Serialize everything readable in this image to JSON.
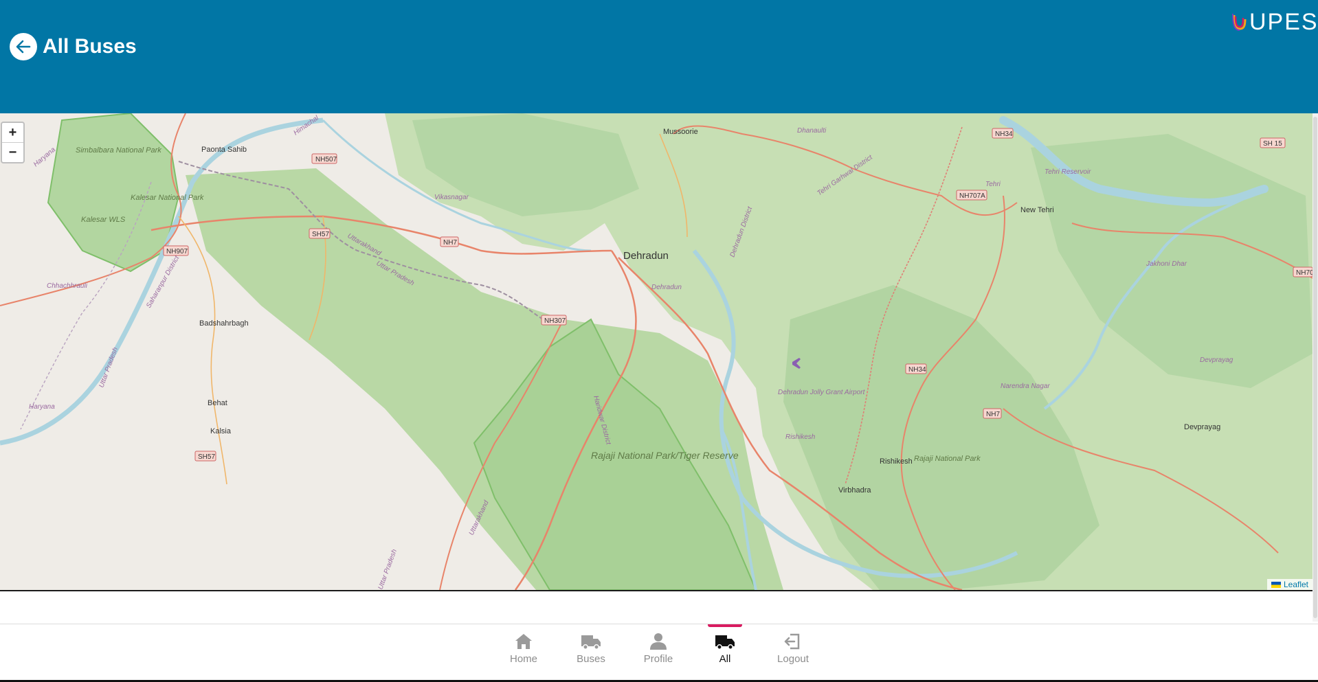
{
  "header": {
    "title": "All Buses",
    "logo_text": "UPES"
  },
  "map": {
    "zoom_in_label": "+",
    "zoom_out_label": "−",
    "attribution": "Leaflet",
    "places": {
      "dehradun": "Dehradun",
      "mussoorie": "Mussoorie",
      "paonta_sahib": "Paonta Sahib",
      "new_tehri": "New Tehri",
      "rishikesh": "Rishikesh",
      "virbhadra": "Virbhadra",
      "devprayag": "Devprayag",
      "badshahrbagh": "Badshahrbagh",
      "behat": "Behat",
      "kalsia": "Kalsia",
      "dhanaulti": "Dhanaulti",
      "vikasnagar": "Vikasnagar",
      "chhachhrauli": "Chhachhrauli",
      "tehri": "Tehri",
      "dehradun_district_label": "Dehradun",
      "jakhoni_dhar": "Jakhoni Dhar",
      "narendra_nagar": "Narendra Nagar",
      "devprayag_area": "Devprayag",
      "rishikesh_area": "Rishikesh"
    },
    "areas": {
      "simbalbara": "Simbalbara National Park",
      "kalesar_np": "Kalesar National Park",
      "kalesar_wls": "Kalesar WLS",
      "rajaji": "Rajaji National Park/Tiger Reserve",
      "rajaji_small": "Rajaji National Park",
      "tehri_reservoir": "Tehri Reservoir",
      "airport": "Dehradun Jolly Grant Airport"
    },
    "regions": {
      "haryana": "Haryana",
      "haryana2": "Haryana",
      "himachal": "Himachal",
      "uttarakhand": "Uttarakhand",
      "uttar_pradesh": "Uttar Pradesh",
      "uttar_pradesh2": "Uttar Pradesh",
      "uttar_pradesh3": "Uttar Pradesh",
      "uttarakhand2": "Uttarakhand",
      "saharanpur": "Saharanpur District",
      "dehradun_district": "Dehradun District",
      "tehri_garhwal": "Tehri Garhwal District",
      "haridwar": "Haridwar District"
    },
    "roads": {
      "nh507": "NH507",
      "sh57a": "SH57",
      "nh7a": "NH7",
      "nh907": "NH907",
      "nh307": "NH307",
      "sh57b": "SH57",
      "nh34a": "NH34",
      "nh707a": "NH707A",
      "nh34b": "NH34",
      "nh7b": "NH7",
      "sh15": "SH 15",
      "nh7c": "NH70"
    }
  },
  "nav": {
    "items": [
      {
        "label": "Home",
        "icon": "home-icon"
      },
      {
        "label": "Buses",
        "icon": "bus-icon"
      },
      {
        "label": "Profile",
        "icon": "profile-icon"
      },
      {
        "label": "All",
        "icon": "truck-icon",
        "active": true
      },
      {
        "label": "Logout",
        "icon": "logout-icon"
      }
    ]
  },
  "colors": {
    "header_bg": "#0176a5",
    "active_indicator": "#d81b60",
    "forest": "#add19e",
    "park": "#c8e0b3",
    "road": "#e8846a",
    "water": "#aad3df"
  }
}
